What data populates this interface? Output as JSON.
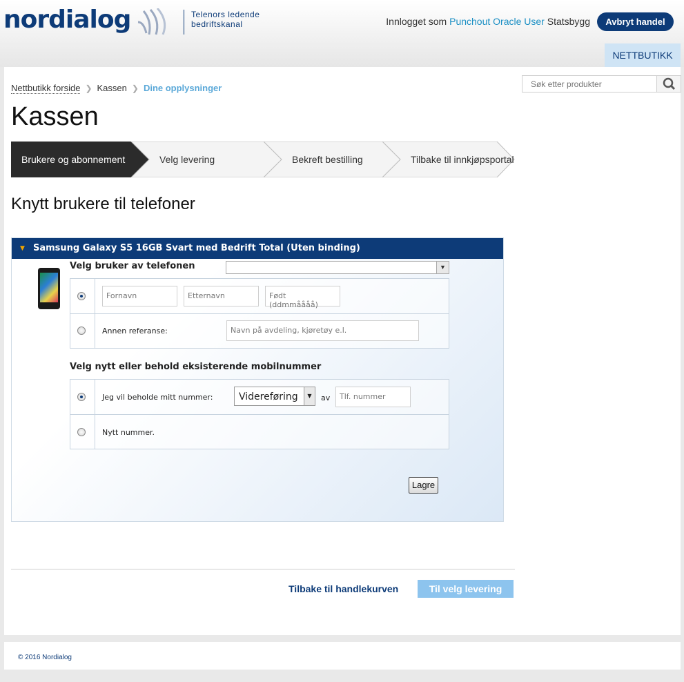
{
  "header": {
    "logo_text": "nordialog",
    "tagline_line1": "Telenors ledende",
    "tagline_line2": "bedriftskanal",
    "login_prefix": "Innlogget som",
    "login_user": "Punchout Oracle User",
    "login_org": "Statsbygg",
    "abort_button": "Avbryt handel",
    "nav_tab": "NETTBUTIKK"
  },
  "breadcrumb": {
    "items": [
      "Nettbutikk forside",
      "Kassen"
    ],
    "current": "Dine opplysninger"
  },
  "search": {
    "placeholder": "Søk etter produkter"
  },
  "page_title": "Kassen",
  "steps": [
    {
      "label": "Brukere og abonnement",
      "active": true
    },
    {
      "label": "Velg levering",
      "active": false
    },
    {
      "label": "Bekreft bestilling",
      "active": false
    },
    {
      "label": "Tilbake til innkjøpsportal",
      "active": false
    }
  ],
  "section_title": "Knytt brukere til telefoner",
  "panel": {
    "title": "Samsung Galaxy S5 16GB Svart med Bedrift Total (Uten binding)",
    "user_label": "Velg bruker av telefonen",
    "user_select_value": "",
    "firstname_placeholder": "Fornavn",
    "lastname_placeholder": "Etternavn",
    "birth_placeholder": "Født (ddmmåååå)",
    "other_ref_label": "Annen referanse:",
    "other_ref_placeholder": "Navn på avdeling, kjøretøy e.l.",
    "number_label": "Velg nytt eller behold eksisterende mobilnummer",
    "keep_label": "Jeg vil beholde mitt nummer:",
    "transfer_value": "Videreføring",
    "av_label": "av",
    "phone_placeholder": "Tlf. nummer",
    "new_number_label": "Nytt nummer.",
    "save_button": "Lagre"
  },
  "actions": {
    "back_link": "Tilbake til handlekurven",
    "next_button": "Til velg levering"
  },
  "footer": {
    "copyright": "© 2016 Nordialog"
  },
  "colors": {
    "brand_navy": "#0d3b78",
    "link_blue": "#1b8fc4",
    "next_button": "#8dc4ee",
    "active_step": "#2b2b2b"
  }
}
